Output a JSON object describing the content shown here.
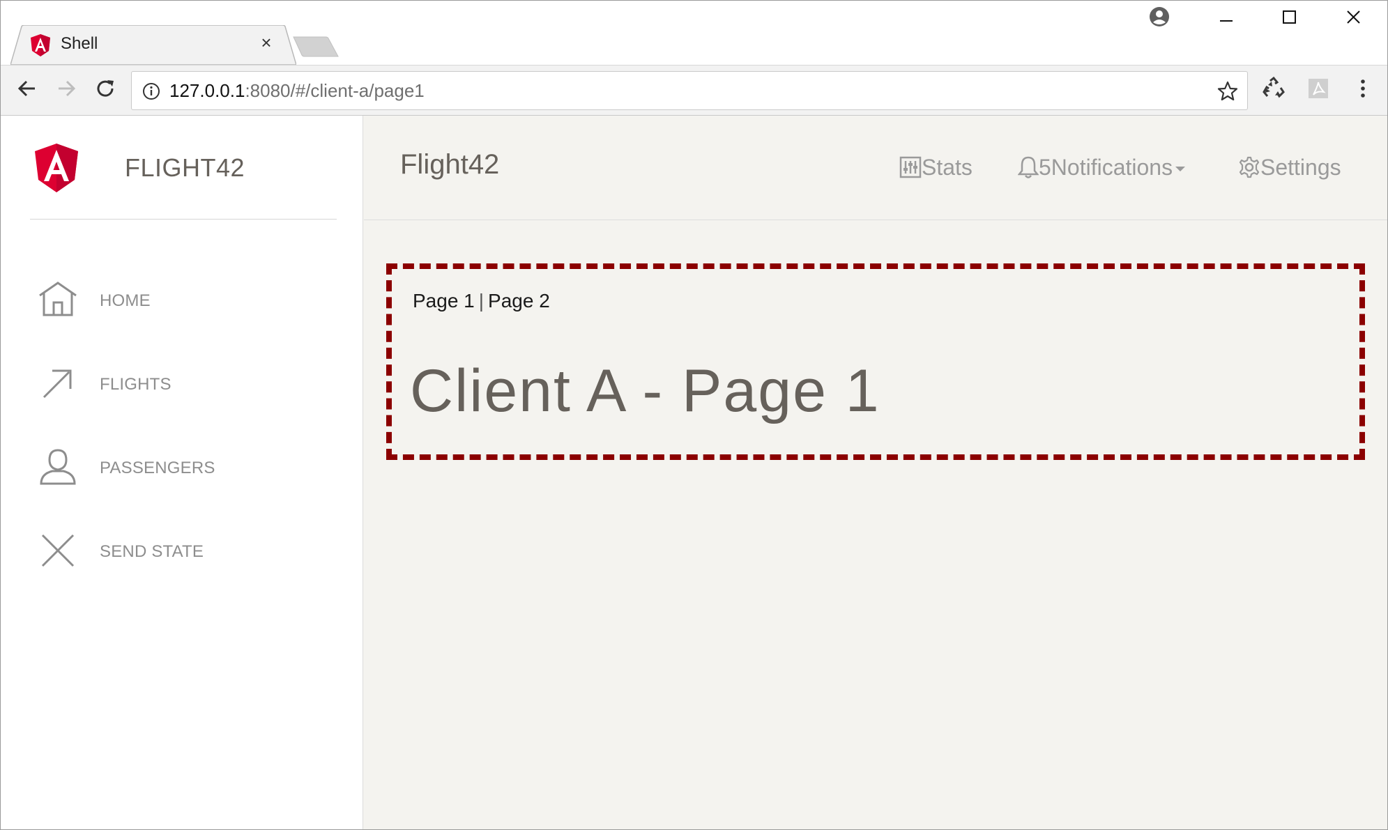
{
  "browser": {
    "tab_title": "Shell",
    "tab_close": "×",
    "url_host": "127.0.0.1",
    "url_rest": ":8080/#/client-a/page1"
  },
  "sidebar": {
    "brand": "FLIGHT42",
    "items": [
      {
        "label": "HOME",
        "icon": "home-icon"
      },
      {
        "label": "FLIGHTS",
        "icon": "arrow-up-right-icon"
      },
      {
        "label": "PASSENGERS",
        "icon": "user-icon"
      },
      {
        "label": "SEND STATE",
        "icon": "close-icon"
      }
    ]
  },
  "header": {
    "title": "Flight42",
    "stats_label": "Stats",
    "notifications_count": "5",
    "notifications_label": "Notifications",
    "settings_label": "Settings"
  },
  "client": {
    "link1": "Page 1",
    "separator": "|",
    "link2": "Page 2",
    "heading": "Client A - Page 1"
  },
  "colors": {
    "angular_red": "#dd0031",
    "dashed_border": "#8b0000",
    "page_bg": "#f4f3ef",
    "muted_text": "#66615b"
  }
}
